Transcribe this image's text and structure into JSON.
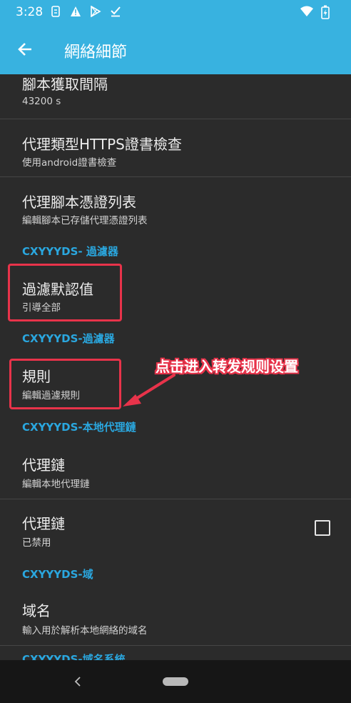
{
  "status_bar": {
    "time": "3:28",
    "icons": [
      "sim-icon",
      "warning-icon",
      "play-store-icon",
      "check-icon"
    ],
    "right_icons": [
      "wifi-icon",
      "battery-charging-icon"
    ]
  },
  "toolbar": {
    "title": "網絡細節",
    "back_icon": "arrow-left-icon"
  },
  "items": [
    {
      "title": "腳本獲取間隔",
      "subtitle": "43200 s"
    },
    {
      "title": "代理類型HTTPS證書檢查",
      "subtitle": "使用android證書檢查"
    },
    {
      "title": "代理腳本憑證列表",
      "subtitle": "編輯腳本已存儲代理憑證列表"
    },
    {
      "title": "過濾默認值",
      "subtitle": "引導全部"
    },
    {
      "title": "規則",
      "subtitle": "編輯過濾規則"
    },
    {
      "title": "代理鏈",
      "subtitle": "編輯本地代理鏈"
    },
    {
      "title": "代理鏈",
      "subtitle": "已禁用",
      "checked": false
    },
    {
      "title": "域名",
      "subtitle": "輸入用於解析本地網絡的域名"
    }
  ],
  "sections": [
    {
      "label": "CXYYYDS- 過濾器"
    },
    {
      "label": "CXYYYDS-過濾器"
    },
    {
      "label": "CXYYYDS-本地代理鏈"
    },
    {
      "label": "CXYYYDS-域"
    },
    {
      "label": "CXYYYDS-域名系統"
    }
  ],
  "annotation": {
    "text": "点击进入转发规则设置",
    "color": "#e8334a"
  },
  "colors": {
    "accent": "#38b2e0",
    "section": "#2aa7df",
    "background": "#2b2b2b",
    "highlight": "#e8334a"
  },
  "nav_bar": {
    "back_icon": "nav-back-icon",
    "home_icon": "nav-home-pill"
  }
}
